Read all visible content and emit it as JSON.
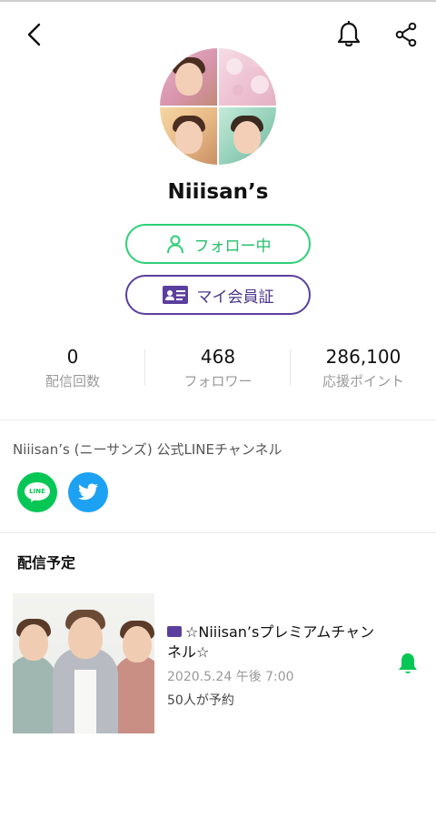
{
  "header": {
    "back_icon": "chevron-left-icon",
    "bell_icon": "bell-icon",
    "share_icon": "share-icon"
  },
  "profile": {
    "name": "Niiisan’s",
    "follow_label": "フォロー中",
    "member_label": "マイ会員証"
  },
  "stats": [
    {
      "value": "0",
      "label": "配信回数"
    },
    {
      "value": "468",
      "label": "フォロワー"
    },
    {
      "value": "286,100",
      "label": "応援ポイント"
    }
  ],
  "description": "Niiisan’s (ニーサンズ) 公式LINEチャンネル",
  "sns": {
    "line_label": "LINE",
    "twitter_icon": "twitter-bird-icon"
  },
  "schedule": {
    "section_title": "配信予定",
    "event": {
      "title": "☆Niiisan’sプレミアムチャンネル☆",
      "date": "2020.5.24 午後 7:00",
      "reservations": "50人が予約"
    }
  },
  "colors": {
    "accent_green": "#2fcf77",
    "member_purple": "#5b3f9e",
    "line_green": "#06c755",
    "twitter_blue": "#1da1f2"
  }
}
